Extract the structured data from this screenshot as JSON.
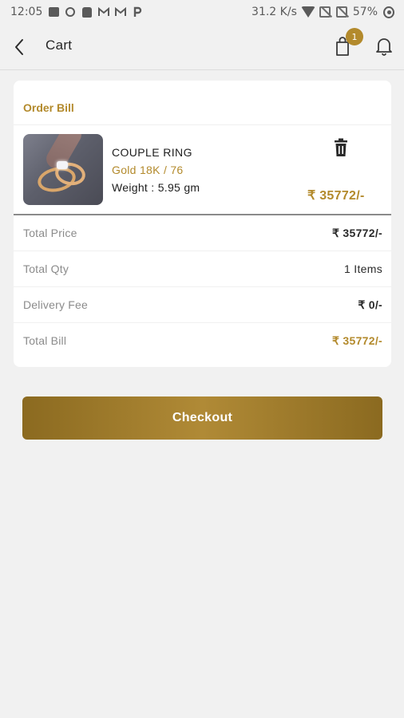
{
  "status_bar": {
    "time": "12:05",
    "net_speed": "31.2 K/s",
    "battery": "57%"
  },
  "app_bar": {
    "title": "Cart",
    "cart_badge": "1"
  },
  "order_bill": {
    "title": "Order Bill",
    "item": {
      "name": "COUPLE RING",
      "variant": "Gold 18K / 76",
      "weight": "Weight : 5.95 gm",
      "price": "₹ 35772/-"
    },
    "rows": [
      {
        "label": "Total Price",
        "value": "₹ 35772/-"
      },
      {
        "label": "Total Qty",
        "value": "1 Items"
      },
      {
        "label": "Delivery Fee",
        "value": "₹ 0/-"
      },
      {
        "label": "Total Bill",
        "value": "₹ 35772/-"
      }
    ]
  },
  "checkout": {
    "label": "Checkout"
  },
  "colors": {
    "accent": "#b38a2c",
    "background": "#f1f1f1"
  }
}
